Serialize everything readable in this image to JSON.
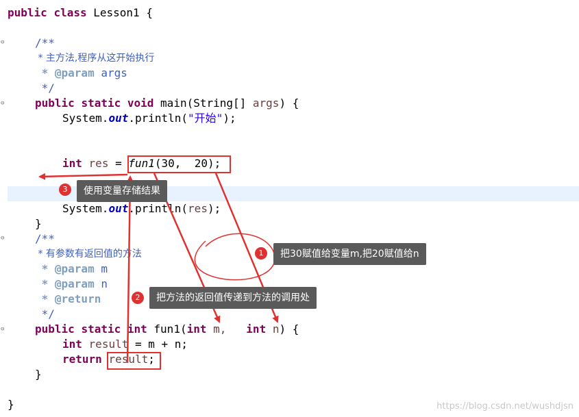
{
  "code": {
    "class_decl": {
      "kw1": "public",
      "kw2": "class",
      "name": "Lesson1",
      "brace": "{"
    },
    "doc1": {
      "open": "/**",
      "desc": " * 主方法,程序从这开始执行",
      "tag": " * @param",
      "param": " args",
      "close": " */"
    },
    "main_sig": {
      "kw1": "public",
      "kw2": "static",
      "kw3": "void",
      "rest": "main(String[] ",
      "var": "args",
      "end": ") {"
    },
    "print1": {
      "pre": "System.",
      "field": "out",
      "mid": ".println(",
      "str": "\"开始\"",
      "end": ");"
    },
    "assign": {
      "kw": "int",
      "var": "res",
      "eq": " = ",
      "call": "fun1",
      "args": "(30,  20);"
    },
    "print2": {
      "pre": "System.",
      "field": "out",
      "mid": ".println(",
      "var": "res",
      "end": ");"
    },
    "close_main": "}",
    "doc2": {
      "open": "/**",
      "desc": " * 有参数有返回值的方法",
      "tag_m": " * @param",
      "param_m": " m",
      "tag_n": " * @param",
      "param_n": " n",
      "tag_r": " * @return",
      "close": " */"
    },
    "fun_sig": {
      "kw1": "public",
      "kw2": "static",
      "kw3": "int",
      "name": " fun1(",
      "kw4": "int",
      "pm": " m,",
      "kw5": "int",
      "pn": " n",
      "end": ") {"
    },
    "result_line": {
      "kw": "int",
      "var": "result",
      "rest": " = m + n;"
    },
    "return_line": {
      "kw": "return",
      "var": "result",
      "end": ";"
    },
    "close_fun": "}",
    "close_class": "}"
  },
  "annotations": [
    {
      "num": "1",
      "text": "把30赋值给变量m,把20赋值给n"
    },
    {
      "num": "2",
      "text": "把方法的返回值传递到方法的调用处"
    },
    {
      "num": "3",
      "text": "使用变量存储结果"
    }
  ],
  "colors": {
    "keyword": "#7f0055",
    "comment": "#3f5fbf",
    "annotation": "#e03131",
    "bubble": "#5a5a5a"
  },
  "watermark": "https://blog.csdn.net/wushdjsn"
}
